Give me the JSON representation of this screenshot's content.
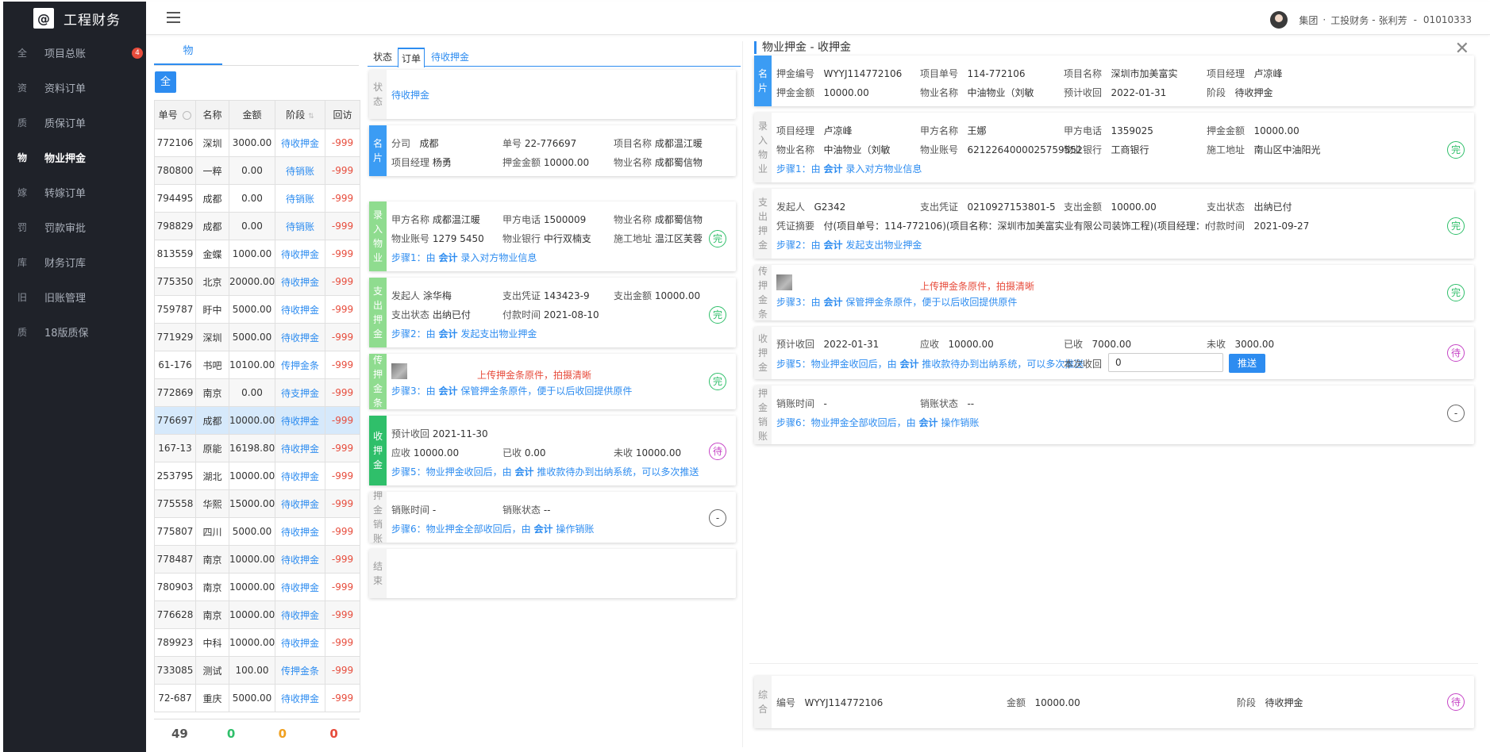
{
  "app": {
    "title": "工程财务",
    "logo_glyph": "@"
  },
  "user": {
    "org": "集团",
    "dept": "工投财务",
    "name": "张利芳",
    "id": "01010333",
    "sep": "·"
  },
  "sidebar": {
    "items": [
      {
        "icon": "全",
        "label": "项目总账",
        "badge": "4"
      },
      {
        "icon": "资",
        "label": "资料订单"
      },
      {
        "icon": "质",
        "label": "质保订单"
      },
      {
        "icon": "物",
        "label": "物业押金",
        "active": true
      },
      {
        "icon": "嫁",
        "label": "转嫁订单"
      },
      {
        "icon": "罚",
        "label": "罚款审批"
      },
      {
        "icon": "库",
        "label": "财务订库"
      },
      {
        "icon": "旧",
        "label": "旧账管理"
      },
      {
        "icon": "质",
        "label": "18版质保"
      }
    ]
  },
  "list": {
    "tab": "物",
    "all_btn": "全",
    "columns": [
      "单号",
      "名称",
      "金额",
      "阶段",
      "回访"
    ],
    "rows": [
      [
        "772106",
        "深圳",
        "3000.00",
        "待收押金",
        "-999"
      ],
      [
        "780800",
        "一粹",
        "0.00",
        "待销账",
        "-999"
      ],
      [
        "794495",
        "成都",
        "0.00",
        "待销账",
        "-999"
      ],
      [
        "798829",
        "成都",
        "0.00",
        "待销账",
        "-999"
      ],
      [
        "813559",
        "金蝶",
        "1000.00",
        "待收押金",
        "-999"
      ],
      [
        "775350",
        "北京",
        "20000.00",
        "待收押金",
        "-999"
      ],
      [
        "759787",
        "盱中",
        "5000.00",
        "待收押金",
        "-999"
      ],
      [
        "771929",
        "深圳",
        "5000.00",
        "待收押金",
        "-999"
      ],
      [
        "61-176",
        "书吧",
        "10100.00",
        "传押金条",
        "-999"
      ],
      [
        "772869",
        "南京",
        "0.00",
        "待支押金",
        "-999"
      ],
      [
        "776697",
        "成都",
        "10000.00",
        "待收押金",
        "-999"
      ],
      [
        "167-13",
        "原能",
        "16198.80",
        "待收押金",
        "-999"
      ],
      [
        "253795",
        "湖北",
        "10000.00",
        "待收押金",
        "-999"
      ],
      [
        "775558",
        "华熙",
        "15000.00",
        "待收押金",
        "-999"
      ],
      [
        "775807",
        "四川",
        "5000.00",
        "待收押金",
        "-999"
      ],
      [
        "778487",
        "南京",
        "10000.00",
        "待收押金",
        "-999"
      ],
      [
        "780903",
        "南京",
        "10000.00",
        "待收押金",
        "-999"
      ],
      [
        "776628",
        "南京",
        "10000.00",
        "待收押金",
        "-999"
      ],
      [
        "789923",
        "中科",
        "10000.00",
        "待收押金",
        "-999"
      ],
      [
        "733085",
        "测试",
        "100.00",
        "传押金条",
        "-999"
      ],
      [
        "72-687",
        "重庆",
        "5000.00",
        "待收押金",
        "-999"
      ]
    ],
    "totals": [
      "49",
      "0",
      "0",
      "0"
    ],
    "colors": {
      "total": "#555555",
      "green": "#2fbf6a",
      "orange": "#f0a020",
      "red": "#e74c3c"
    }
  },
  "mid": {
    "tabs": [
      "状态",
      "订单",
      "待收押金"
    ],
    "status": {
      "label": "状态",
      "value": "待收押金"
    },
    "card_mingpian": {
      "label": "名片",
      "branch_k": "分司",
      "branch_v": "成都",
      "no_k": "单号",
      "no_v": "22-776697",
      "pname_k": "项目名称",
      "pname_v": "成都温江暖",
      "pm_k": "项目经理",
      "pm_v": "杨勇",
      "amt_k": "押金金额",
      "amt_v": "10000.00",
      "prop_k": "物业名称",
      "prop_v": "成都蜀信物"
    },
    "card_luru": {
      "label": "录入物业",
      "party_k": "甲方名称",
      "party_v": "成都温江暖",
      "tel_k": "甲方电话",
      "tel_v": "1500009",
      "prop_k": "物业名称",
      "prop_v": "成都蜀信物",
      "acct_k": "物业账号",
      "acct_v": "1279 5450",
      "bank_k": "物业银行",
      "bank_v": "中行双楠支",
      "addr_k": "施工地址",
      "addr_v": "温江区芙蓉",
      "step": "步骤1：由",
      "role": "会计",
      "action": "录入对方物业信息",
      "status": "完"
    },
    "card_zhichu": {
      "label": "支出押金",
      "init_k": "发起人",
      "init_v": "涂华梅",
      "voucher_k": "支出凭证",
      "voucher_v": "143423-9",
      "amt_k": "支出金额",
      "amt_v": "10000.00",
      "state_k": "支出状态",
      "state_v": "出纳已付",
      "paytime_k": "付款时间",
      "paytime_v": "2021-08-10",
      "step": "步骤2：由",
      "role": "会计",
      "action": "发起支出物业押金",
      "status": "完"
    },
    "card_chuan": {
      "label": "传押金条",
      "upload": "上传押金条原件，拍摄清晰",
      "step": "步骤3：由",
      "role": "会计",
      "action": "保管押金条原件，便于以后收回提供原件",
      "status": "完"
    },
    "card_shou": {
      "label": "收押金",
      "exp_k": "预计收回",
      "exp_v": "2021-11-30",
      "recv_k": "应收",
      "recv_v": "10000.00",
      "got_k": "已收",
      "got_v": "0.00",
      "un_k": "未收",
      "un_v": "10000.00",
      "step": "步骤5：物业押金收回后，由",
      "role": "会计",
      "action": "推收款待办到出纳系统，可以多次推送",
      "status": "待"
    },
    "card_xiao": {
      "label": "押金销账",
      "time_k": "销账时间",
      "time_v": "-",
      "state_k": "销账状态",
      "state_v": "--",
      "step": "步骤6：物业押金全部收回后，由",
      "role": "会计",
      "action": "操作销账",
      "status": "-"
    },
    "card_end": {
      "label": "结束"
    }
  },
  "right": {
    "title": "物业押金 - 收押金",
    "card_mingpian": {
      "label": "名片",
      "no_k": "押金编号",
      "no_v": "WYYJ114772106",
      "pno_k": "项目单号",
      "pno_v": "114-772106",
      "pname_k": "项目名称",
      "pname_v": "深圳市加美富实",
      "pm_k": "项目经理",
      "pm_v": "卢凉峰",
      "amt_k": "押金金额",
      "amt_v": "10000.00",
      "prop_k": "物业名称",
      "prop_v": "中油物业（刘敏",
      "exp_k": "预计收回",
      "exp_v": "2022-01-31",
      "stage_k": "阶段",
      "stage_v": "待收押金"
    },
    "card_luru": {
      "label": "录入物业",
      "pm_k": "项目经理",
      "pm_v": "卢凉峰",
      "party_k": "甲方名称",
      "party_v": "王娜",
      "tel_k": "甲方电话",
      "tel_v": "1359025",
      "amt_k": "押金金额",
      "amt_v": "10000.00",
      "prop_k": "物业名称",
      "prop_v": "中油物业（刘敏",
      "acct_k": "物业账号",
      "acct_v": "6212264000025759552",
      "bank_k": "物业银行",
      "bank_v": "工商银行",
      "addr_k": "施工地址",
      "addr_v": "南山区中油阳光",
      "step": "步骤1：由",
      "role": "会计",
      "action": "录入对方物业信息",
      "status": "完"
    },
    "card_zhichu": {
      "label": "支出押金",
      "init_k": "发起人",
      "init_v": "G2342",
      "voucher_k": "支出凭证",
      "voucher_v": "0210927153801-5",
      "amt_k": "支出金额",
      "amt_v": "10000.00",
      "state_k": "支出状态",
      "state_v": "出纳已付",
      "memo_k": "凭证摘要",
      "memo_v": "付(项目单号：114-772106)(项目名称：深圳市加美富实业有限公司装饰工程)(项目经理：nul",
      "paytime_k": "付款时间",
      "paytime_v": "2021-09-27",
      "step": "步骤2：由",
      "role": "会计",
      "action": "发起支出物业押金",
      "status": "完"
    },
    "card_chuan": {
      "label": "传押金条",
      "upload": "上传押金条原件，拍摄清晰",
      "step": "步骤3：由",
      "role": "会计",
      "action": "保管押金条原件，便于以后收回提供原件",
      "status": "完"
    },
    "card_shou": {
      "label": "收押金",
      "exp_k": "预计收回",
      "exp_v": "2022-01-31",
      "recv_k": "应收",
      "recv_v": "10000.00",
      "got_k": "已收",
      "got_v": "7000.00",
      "un_k": "未收",
      "un_v": "3000.00",
      "step": "步骤5：物业押金收回后，由",
      "role": "会计",
      "action": "推收款待办到出纳系统，可以多次推送",
      "cur_k": "本次收回",
      "cur_v": "0",
      "push": "推送",
      "status": "待"
    },
    "card_xiao": {
      "label": "押金销账",
      "time_k": "销账时间",
      "time_v": "-",
      "state_k": "销账状态",
      "state_v": "--",
      "step": "步骤6：物业押金全部收回后，由",
      "role": "会计",
      "action": "操作销账",
      "status": "-"
    },
    "card_zonghe": {
      "label": "综合",
      "no_k": "编号",
      "no_v": "WYYJ114772106",
      "amt_k": "金额",
      "amt_v": "10000.00",
      "stage_k": "阶段",
      "stage_v": "待收押金",
      "status": "待"
    }
  }
}
